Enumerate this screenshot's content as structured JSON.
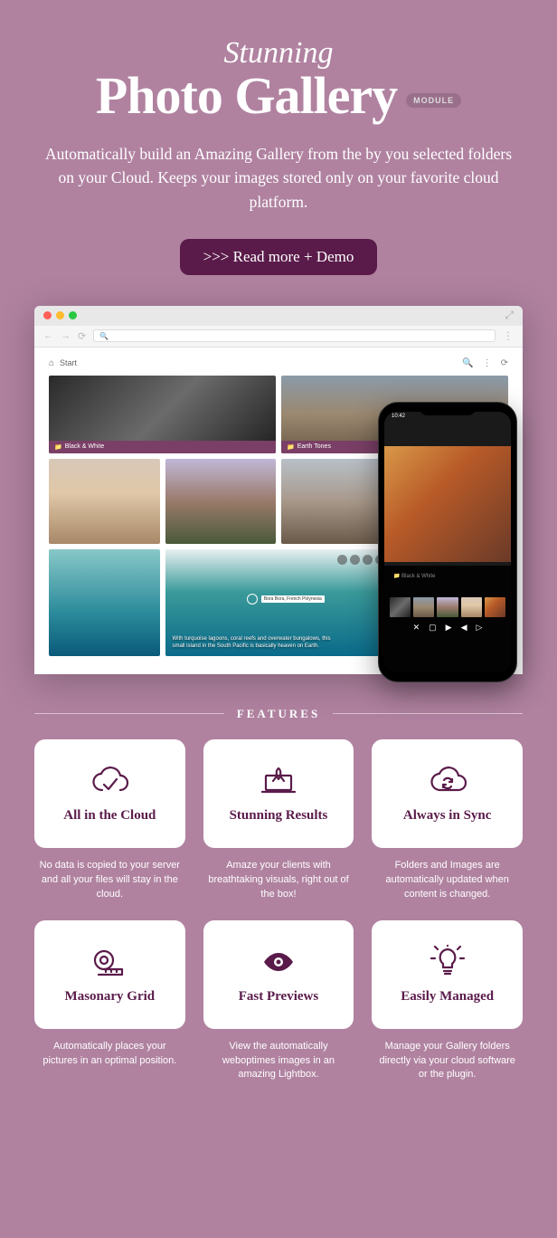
{
  "header": {
    "pretitle": "Stunning",
    "title": "Photo Gallery",
    "badge": "MODULE",
    "subtitle": "Automatically build an Amazing Gallery from the by you selected folders on your Cloud. Keeps your images stored only on your favorite cloud platform.",
    "cta": ">>> Read more + Demo"
  },
  "appbar": {
    "start": "Start"
  },
  "tiles": {
    "bw_label": "Black & White",
    "earth_label": "Earth Tones",
    "pin_location": "Bora Bora, French Polynesia",
    "caption1": "With turquoise lagoons, coral reefs and overwater bungalows, this",
    "caption2": "small island in the South Pacific is basically heaven on Earth."
  },
  "phone": {
    "time": "10:42",
    "label": "Black & White"
  },
  "features": {
    "heading": "FEATURES",
    "items": [
      {
        "title": "All in the Cloud",
        "desc": "No data is copied to your server and all your files will stay in the cloud."
      },
      {
        "title": "Stunning Results",
        "desc": "Amaze your clients with breathtaking visuals, right out of the box!"
      },
      {
        "title": "Always in Sync",
        "desc": "Folders and Images are automatically updated when content is changed."
      },
      {
        "title": "Masonary Grid",
        "desc": "Automatically places your pictures in an optimal position."
      },
      {
        "title": "Fast Previews",
        "desc": "View the automatically weboptimes images in an amazing Lightbox."
      },
      {
        "title": "Easily Managed",
        "desc": "Manage your Gallery folders directly via your cloud software or the plugin."
      }
    ]
  }
}
